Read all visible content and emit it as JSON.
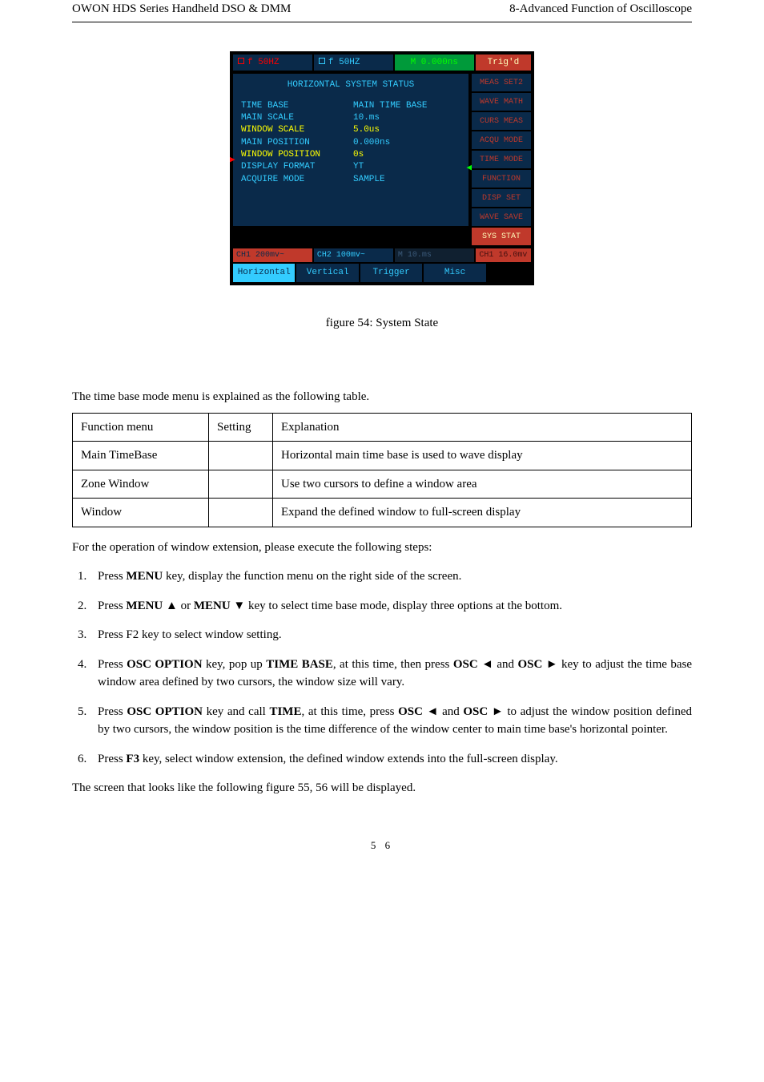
{
  "header": {
    "left": "OWON   HDS Series Handheld DSO & DMM",
    "right": "8-Advanced Function of Oscilloscope"
  },
  "scope": {
    "top": {
      "ch1": "f 50HZ",
      "ch2": "f 50HZ",
      "time": "M 0.000ns",
      "trig": "Trig'd"
    },
    "heading": "HORIZONTAL SYSTEM STATUS",
    "rows": [
      {
        "label": "TIME BASE",
        "value": "MAIN TIME BASE",
        "color1": "cyan",
        "color2": "cyan"
      },
      {
        "label": "MAIN SCALE",
        "value": "10.ms",
        "color1": "cyan",
        "color2": "cyan"
      },
      {
        "label": "WINDOW SCALE",
        "value": "5.0us",
        "color1": "yellow",
        "color2": "yellow"
      },
      {
        "label": "MAIN POSITION",
        "value": "0.000ns",
        "color1": "cyan",
        "color2": "cyan"
      },
      {
        "label": "WINDOW POSITION",
        "value": "0s",
        "color1": "yellow",
        "color2": "yellow"
      },
      {
        "label": "DISPLAY FORMAT",
        "value": "YT",
        "color1": "cyan",
        "color2": "cyan"
      },
      {
        "label": "ACQUIRE MODE",
        "value": "SAMPLE",
        "color1": "cyan",
        "color2": "cyan"
      }
    ],
    "side_menu": [
      "MEAS SET2",
      "WAVE MATH",
      "CURS MEAS",
      "ACQU MODE",
      "TIME MODE",
      "FUNCTION",
      "DISP SET",
      "WAVE SAVE",
      "SYS STAT"
    ],
    "status": {
      "ch1": "CH1 200mv~",
      "ch2": "CH2 100mv~",
      "m": "M 10.ms",
      "trig": "CH1 16.0mv"
    },
    "tabs": [
      "Horizontal",
      "Vertical",
      "Trigger",
      "Misc"
    ]
  },
  "figure_caption": "figure 54: System State",
  "lead_text": "The time base mode menu is explained as the following table.",
  "table": {
    "header": [
      "Function menu",
      "Setting",
      "Explanation"
    ],
    "rows": [
      [
        "Main TimeBase",
        "",
        "Horizontal main time base is used to wave display"
      ],
      [
        "Zone Window",
        "",
        "Use two cursors to define a window area"
      ],
      [
        "Window",
        "",
        "Expand the defined window to full-screen display"
      ]
    ]
  },
  "after_table": "For the operation of window extension, please execute the following steps:",
  "steps": [
    "Press <b>MENU</b> key, display the function menu on the right side of the screen.",
    "Press <b>MENU</b>  ▲ or <b>MENU</b>  ▼ key to select time base mode, display three options at the bottom.",
    "Press F2 key to select window setting.",
    "Press <b>OSC OPTION</b> key, pop up <b>TIME BASE</b>, at this time, then press <b>OSC</b> ◄ and <b>OSC</b> ► key to adjust the time base window area defined by two cursors, the window size will vary.",
    "Press <b>OSC OPTION</b> key and call <b>TIME</b>, at this time, press <b>OSC</b> ◄ and <b>OSC</b> ►  to adjust the window position defined by two cursors, the window position is the time difference of the window center to main time base's horizontal pointer.",
    "Press <b>F3</b> key, select window extension, the defined window extends into the full-screen display."
  ],
  "closing": "The screen that looks like the following figure 55, 56 will be displayed.",
  "page_num": "5 6"
}
